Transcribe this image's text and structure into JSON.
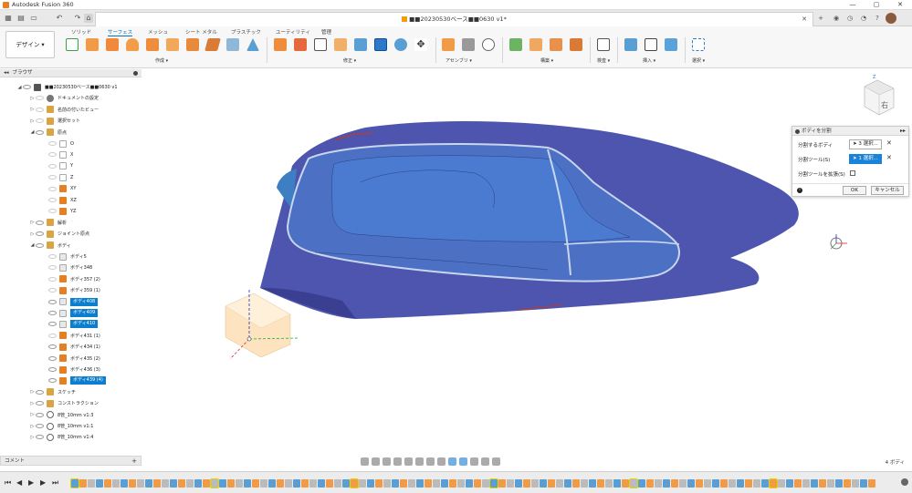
{
  "window": {
    "title": "Autodesk Fusion 360",
    "controls": [
      "—",
      "▢",
      "✕"
    ]
  },
  "doc_tab": {
    "title": "■■20230530ベース■■0630 v1*",
    "close": "✕"
  },
  "ribbon": {
    "workspace_button": "デザイン ▾",
    "tabs": [
      "ソリッド",
      "サーフェス",
      "メッシュ",
      "シート メタル",
      "プラスチック",
      "ユーティリティ",
      "管理"
    ],
    "active_tab_index": 1,
    "groups": [
      "作成 ▾",
      "修正 ▾",
      "アセンブリ ▾",
      "構築 ▾",
      "検査 ▾",
      "挿入 ▾",
      "選択 ▾"
    ]
  },
  "browser": {
    "header": "ブラウザ",
    "items": [
      {
        "label": "■■20230530ベース■■0630 v1",
        "indent": 0,
        "twisty": "◢",
        "icon": "comp",
        "eye": true,
        "sel": false,
        "gray": false
      },
      {
        "label": "ドキュメントの設定",
        "indent": 1,
        "twisty": "▷",
        "icon": "gear",
        "eye": false,
        "sel": false,
        "gray": false
      },
      {
        "label": "名前の付いたビュー",
        "indent": 1,
        "twisty": "▷",
        "icon": "folder",
        "eye": false,
        "sel": false,
        "gray": false
      },
      {
        "label": "選択セット",
        "indent": 1,
        "twisty": "▷",
        "icon": "folder",
        "eye": false,
        "sel": false,
        "gray": false
      },
      {
        "label": "原点",
        "indent": 1,
        "twisty": "◢",
        "icon": "folder",
        "eye": true,
        "sel": false,
        "gray": false
      },
      {
        "label": "O",
        "indent": 2,
        "twisty": "",
        "icon": "origin",
        "eye": false,
        "sel": false,
        "gray": false
      },
      {
        "label": "X",
        "indent": 2,
        "twisty": "",
        "icon": "origin",
        "eye": false,
        "sel": false,
        "gray": false
      },
      {
        "label": "Y",
        "indent": 2,
        "twisty": "",
        "icon": "origin",
        "eye": false,
        "sel": false,
        "gray": false
      },
      {
        "label": "Z",
        "indent": 2,
        "twisty": "",
        "icon": "origin",
        "eye": false,
        "sel": false,
        "gray": false
      },
      {
        "label": "XY",
        "indent": 2,
        "twisty": "",
        "icon": "bodyo",
        "eye": false,
        "sel": false,
        "gray": false
      },
      {
        "label": "XZ",
        "indent": 2,
        "twisty": "",
        "icon": "bodyo",
        "eye": false,
        "sel": false,
        "gray": false
      },
      {
        "label": "YZ",
        "indent": 2,
        "twisty": "",
        "icon": "bodyo",
        "eye": false,
        "sel": false,
        "gray": false
      },
      {
        "label": "解析",
        "indent": 1,
        "twisty": "▷",
        "icon": "folder",
        "eye": true,
        "sel": false,
        "gray": false
      },
      {
        "label": "ジョイント原点",
        "indent": 1,
        "twisty": "▷",
        "icon": "folder",
        "eye": true,
        "sel": false,
        "gray": false
      },
      {
        "label": "ボディ",
        "indent": 1,
        "twisty": "◢",
        "icon": "folder",
        "eye": true,
        "sel": false,
        "gray": false
      },
      {
        "label": "ボディ5",
        "indent": 2,
        "twisty": "",
        "icon": "body",
        "eye": false,
        "sel": false,
        "gray": false
      },
      {
        "label": "ボディ348",
        "indent": 2,
        "twisty": "",
        "icon": "body",
        "eye": false,
        "sel": false,
        "gray": false
      },
      {
        "label": "ボディ357 (2)",
        "indent": 2,
        "twisty": "",
        "icon": "bodyo",
        "eye": false,
        "sel": false,
        "gray": false
      },
      {
        "label": "ボディ359 (1)",
        "indent": 2,
        "twisty": "",
        "icon": "bodyo",
        "eye": false,
        "sel": false,
        "gray": false
      },
      {
        "label": "ボディ408",
        "indent": 2,
        "twisty": "",
        "icon": "body",
        "eye": true,
        "sel": true,
        "gray": false
      },
      {
        "label": "ボディ409",
        "indent": 2,
        "twisty": "",
        "icon": "body",
        "eye": true,
        "sel": true,
        "gray": false
      },
      {
        "label": "ボディ410",
        "indent": 2,
        "twisty": "",
        "icon": "body",
        "eye": true,
        "sel": true,
        "gray": false
      },
      {
        "label": "ボディ431 (1)",
        "indent": 2,
        "twisty": "",
        "icon": "bodyo",
        "eye": false,
        "sel": false,
        "gray": false
      },
      {
        "label": "ボディ434 (1)",
        "indent": 2,
        "twisty": "",
        "icon": "bodyo",
        "eye": true,
        "sel": false,
        "gray": false
      },
      {
        "label": "ボディ435 (2)",
        "indent": 2,
        "twisty": "",
        "icon": "bodyo",
        "eye": true,
        "sel": false,
        "gray": false
      },
      {
        "label": "ボディ436 (3)",
        "indent": 2,
        "twisty": "",
        "icon": "bodyo",
        "eye": true,
        "sel": false,
        "gray": false
      },
      {
        "label": "ボディ439 (4)",
        "indent": 2,
        "twisty": "",
        "icon": "bodyo",
        "eye": true,
        "sel": true,
        "gray": false
      },
      {
        "label": "スケッチ",
        "indent": 1,
        "twisty": "▷",
        "icon": "folder",
        "eye": true,
        "sel": false,
        "gray": false
      },
      {
        "label": "コンストラクション",
        "indent": 1,
        "twisty": "▷",
        "icon": "folder",
        "eye": true,
        "sel": false,
        "gray": false
      },
      {
        "label": "8管_10mm v1:3",
        "indent": 1,
        "twisty": "▷",
        "icon": "link",
        "eye": true,
        "sel": false,
        "gray": false
      },
      {
        "label": "8管_10mm v1:1",
        "indent": 1,
        "twisty": "▷",
        "icon": "link",
        "eye": true,
        "sel": false,
        "gray": false
      },
      {
        "label": "8管_10mm v1:4",
        "indent": 1,
        "twisty": "▷",
        "icon": "link",
        "eye": true,
        "sel": false,
        "gray": false
      }
    ]
  },
  "comments": {
    "label": "コメント",
    "add": "+"
  },
  "viewcube": {
    "face_label": "右"
  },
  "split_panel": {
    "title": "ボディを分割",
    "rows": [
      {
        "label": "分割するボディ",
        "button": "3 選択...",
        "active": false,
        "clear": "✕"
      },
      {
        "label": "分割ツール(S)",
        "button": "1 選択...",
        "active": true,
        "clear": "✕"
      }
    ],
    "extend_label": "分割ツールを拡張(S)",
    "ok": "OK",
    "cancel": "キャンセル"
  },
  "status": {
    "selection_count": "4 ボディ"
  },
  "colors": {
    "accent": "#0c7ecf",
    "surface": "#4d55ae",
    "surface_dark": "#3b3f92",
    "highlight": "#c9d6ee",
    "origin_plane": "#fde3bf"
  }
}
